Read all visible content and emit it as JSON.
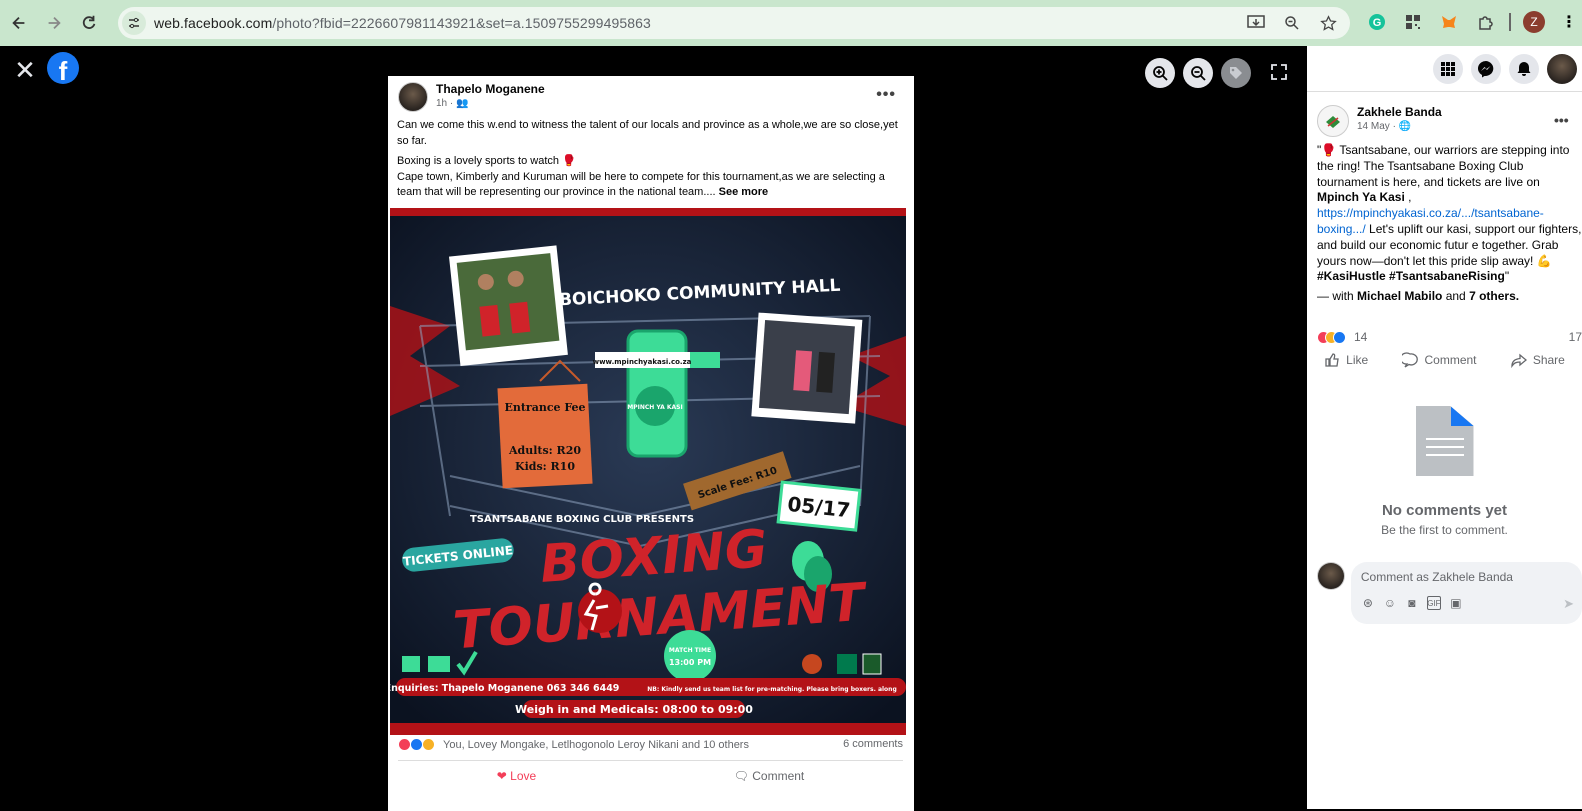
{
  "browser": {
    "url_host": "web.facebook.com",
    "url_path": "/photo?fbid=2226607981143921&set=a.1509755299495863",
    "profile_initial": "Z"
  },
  "post": {
    "author": "Thapelo Moganene",
    "time": "1h",
    "text_p1": "Can we come this w.end to witness the talent of our locals and province as a whole,we are so close,yet so far.",
    "text_p2": "Boxing is a lovely sports to watch 🥊",
    "text_p3": "Cape town, Kimberly and Kuruman will be here to compete for this tournament,as we are selecting a team that will be representing our province in the national team.... ",
    "see_more": "See more",
    "reactions_text": "You, Lovey Mongake, Letlhogonolo Leroy Nikani and 10 others",
    "comments_count": "6 comments",
    "love_label": "Love",
    "comment_label": "Comment"
  },
  "poster": {
    "venue": "BOICHOKO COMMUNITY HALL",
    "website": "www.mpinchyakasi.co.za",
    "entrance_title": "Entrance Fee",
    "adults": "Adults: R20",
    "kids": "Kids: R10",
    "scale_fee": "Scale Fee: R10",
    "date": "05/17",
    "presents": "TSANTSABANE BOXING CLUB PRESENTS",
    "tickets": "TICKETS ONLINE",
    "title1": "BOXING",
    "title2": "TOURNAMENT",
    "match_time_label": "MATCH TIME",
    "match_time": "13:00 PM",
    "enquiries": "Enquiries: Thapelo Moganene 063 346 6449",
    "note": "NB: Kindly send us team list for pre-matching. Please bring boxers. along",
    "weigh_in": "Weigh in and Medicals: 08:00 to 09:00",
    "app_badge": "MPINCH YA KASI"
  },
  "side": {
    "author": "Zakhele Banda",
    "date": "14 May",
    "caption_quote_open": "\"🥊 Tsantsabane, our warriors are stepping into the ring! The Tsantsabane Boxing Club tournament is here, and tickets are live on ",
    "caption_brand": "Mpinch Ya Kasi",
    "caption_comma": " ,",
    "caption_link": "https://mpinchyakasi.co.za/.../tsantsabane-boxing.../",
    "caption_rest": " Let's uplift our kasi, support our fighters, and build our economic futur e together. Grab yours now—don't let this pride slip away! 💪 ",
    "caption_tags": "#KasiHustle #TsantsabaneRising",
    "caption_end": "\"",
    "with_prefix": "— with ",
    "with_name": "Michael Mabilo",
    "with_and": " and ",
    "with_others": "7 others.",
    "reaction_count": "14",
    "share_count": "17",
    "like_label": "Like",
    "comment_label": "Comment",
    "share_label": "Share",
    "no_comments_title": "No comments yet",
    "no_comments_sub": "Be the first to comment.",
    "comment_placeholder": "Comment as Zakhele Banda"
  },
  "colors": {
    "fb_blue": "#1877f2",
    "poster_red": "#b31217",
    "poster_green": "#3ddc97",
    "love_red": "#f33e58"
  }
}
